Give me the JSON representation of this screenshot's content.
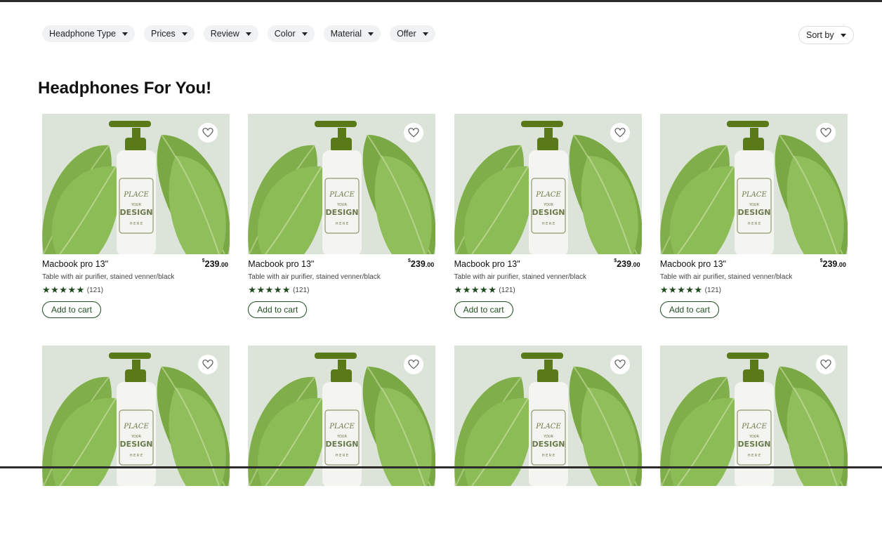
{
  "filters": [
    {
      "label": "Headphone Type"
    },
    {
      "label": "Prices"
    },
    {
      "label": "Review"
    },
    {
      "label": "Color"
    },
    {
      "label": "Material"
    },
    {
      "label": "Offer"
    }
  ],
  "sort_label": "Sort by",
  "page_title": "Headphones For You!",
  "label_text": {
    "line1": "PLACE",
    "line2": "YOUR",
    "line3": "DESIGN",
    "line4": "H E R E"
  },
  "products": [
    {
      "name": "Macbook pro 13\"",
      "currency": "$",
      "price_main": "239",
      "price_cents": ".00",
      "desc": "Table with air purifier, stained venner/black",
      "rating": 5,
      "reviews": "(121)",
      "cart": "Add to cart"
    },
    {
      "name": "Macbook pro 13\"",
      "currency": "$",
      "price_main": "239",
      "price_cents": ".00",
      "desc": "Table with air purifier, stained venner/black",
      "rating": 5,
      "reviews": "(121)",
      "cart": "Add to cart"
    },
    {
      "name": "Macbook pro 13\"",
      "currency": "$",
      "price_main": "239",
      "price_cents": ".00",
      "desc": "Table with air purifier, stained venner/black",
      "rating": 5,
      "reviews": "(121)",
      "cart": "Add to cart"
    },
    {
      "name": "Macbook pro 13\"",
      "currency": "$",
      "price_main": "239",
      "price_cents": ".00",
      "desc": "Table with air purifier, stained venner/black",
      "rating": 5,
      "reviews": "(121)",
      "cart": "Add to cart"
    },
    {
      "name": "",
      "currency": "",
      "price_main": "",
      "price_cents": "",
      "desc": "",
      "rating": 0,
      "reviews": "",
      "cart": ""
    },
    {
      "name": "",
      "currency": "",
      "price_main": "",
      "price_cents": "",
      "desc": "",
      "rating": 0,
      "reviews": "",
      "cart": ""
    },
    {
      "name": "",
      "currency": "",
      "price_main": "",
      "price_cents": "",
      "desc": "",
      "rating": 0,
      "reviews": "",
      "cart": ""
    },
    {
      "name": "",
      "currency": "",
      "price_main": "",
      "price_cents": "",
      "desc": "",
      "rating": 0,
      "reviews": "",
      "cart": ""
    }
  ],
  "icons": {
    "wishlist": "heart-outline-icon",
    "dropdown": "caret-down-icon",
    "star": "star-icon"
  },
  "colors": {
    "accent": "#1f4d1f",
    "chip_bg": "#f0f2f4",
    "star": "#1e4a1e",
    "bottle_cap": "#5a7a1a"
  }
}
